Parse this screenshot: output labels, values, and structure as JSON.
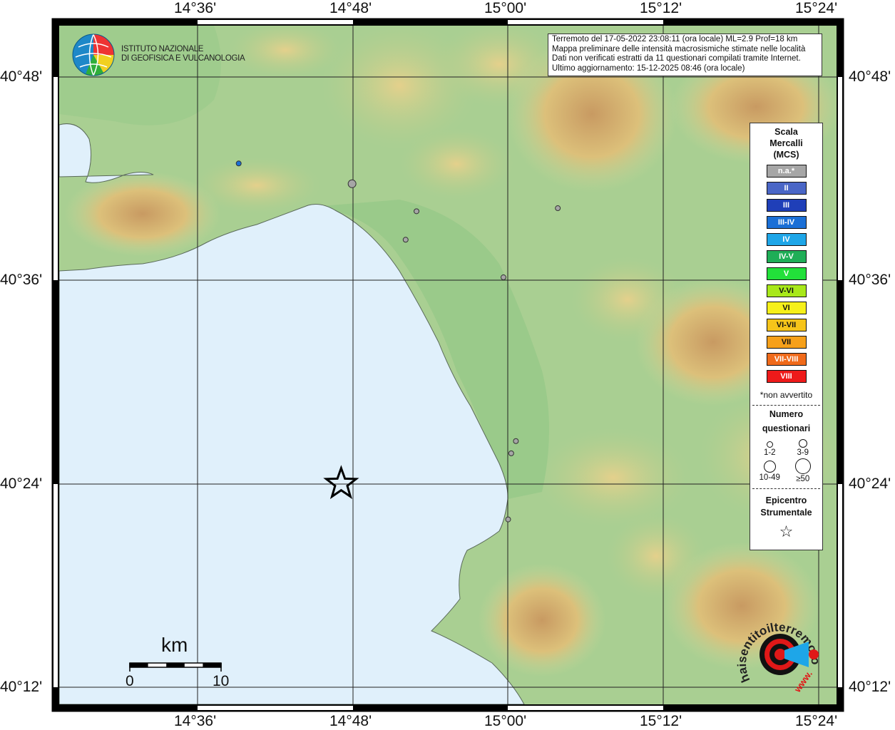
{
  "map": {
    "lon_labels": [
      "14°36'",
      "14°48'",
      "15°00'",
      "15°12'",
      "15°24'"
    ],
    "lat_labels": [
      "40°48'",
      "40°36'",
      "40°24'",
      "40°12'"
    ],
    "epicenter": {
      "lat": 40.4,
      "lon": 14.785
    },
    "points": [
      {
        "lat": 40.715,
        "lon": 14.653,
        "intensity": "III-IV",
        "size": "1-2"
      },
      {
        "lat": 40.695,
        "lon": 14.799,
        "intensity": "n.a.*",
        "size": "3-9"
      },
      {
        "lat": 40.668,
        "lon": 14.882,
        "intensity": "n.a.*",
        "size": "1-2"
      },
      {
        "lat": 40.671,
        "lon": 15.064,
        "intensity": "n.a.*",
        "size": "1-2"
      },
      {
        "lat": 40.64,
        "lon": 14.868,
        "intensity": "n.a.*",
        "size": "1-2"
      },
      {
        "lat": 40.603,
        "lon": 14.994,
        "intensity": "n.a.*",
        "size": "1-2"
      },
      {
        "lat": 40.442,
        "lon": 15.01,
        "intensity": "n.a.*",
        "size": "1-2"
      },
      {
        "lat": 40.43,
        "lon": 15.004,
        "intensity": "n.a.*",
        "size": "1-2"
      },
      {
        "lat": 40.365,
        "lon": 15.0,
        "intensity": "n.a.*",
        "size": "1-2"
      }
    ]
  },
  "info": {
    "line1": "Terremoto del 17-05-2022 23:08:11 (ora locale) ML=2.9 Prof=18 km",
    "line2": "Mappa preliminare delle intensità macrosismiche stimate nelle località",
    "line3": "Dati non verificati estratti da 11 questionari compilati tramite Internet.",
    "line4": "Ultimo aggiornamento: 15-12-2025 08:46 (ora locale)"
  },
  "legend": {
    "title1": "Scala",
    "title2": "Mercalli",
    "title3": "(MCS)",
    "scale": [
      {
        "label": "n.a.*",
        "color": "#a6a6a6"
      },
      {
        "label": "II",
        "color": "#4a66c6"
      },
      {
        "label": "III",
        "color": "#1f3fb8"
      },
      {
        "label": "III-IV",
        "color": "#1a6fd6"
      },
      {
        "label": "IV",
        "color": "#1ea6e8"
      },
      {
        "label": "IV-V",
        "color": "#1fae57"
      },
      {
        "label": "V",
        "color": "#22e03a"
      },
      {
        "label": "V-VI",
        "color": "#a8e81a"
      },
      {
        "label": "VI",
        "color": "#f6f01a"
      },
      {
        "label": "VI-VII",
        "color": "#f6c41a"
      },
      {
        "label": "VII",
        "color": "#f6a01a"
      },
      {
        "label": "VII-VIII",
        "color": "#f06a1a"
      },
      {
        "label": "VIII",
        "color": "#ee1a1a"
      }
    ],
    "note": "*non avvertito",
    "count_title1": "Numero",
    "count_title2": "questionari",
    "sizes": [
      "1-2",
      "3-9",
      "10-49",
      "≥50"
    ],
    "epi_title1": "Epicentro",
    "epi_title2": "Strumentale",
    "star": "☆"
  },
  "scalebar": {
    "unit": "km",
    "start": "0",
    "end": "10"
  },
  "logos": {
    "ingv_line1": "ISTITUTO NAZIONALE",
    "ingv_line2": "DI GEOFISICA E VULCANOLOGIA",
    "hst_text": "haisentitoilterremoto.it",
    "hst_url": "www."
  },
  "colors": {
    "sea": "#e0f0fb",
    "lowland": "#94c88e",
    "hills": "#c8d59a",
    "mountains": "#dcc07a",
    "peaks": "#c89a62"
  }
}
